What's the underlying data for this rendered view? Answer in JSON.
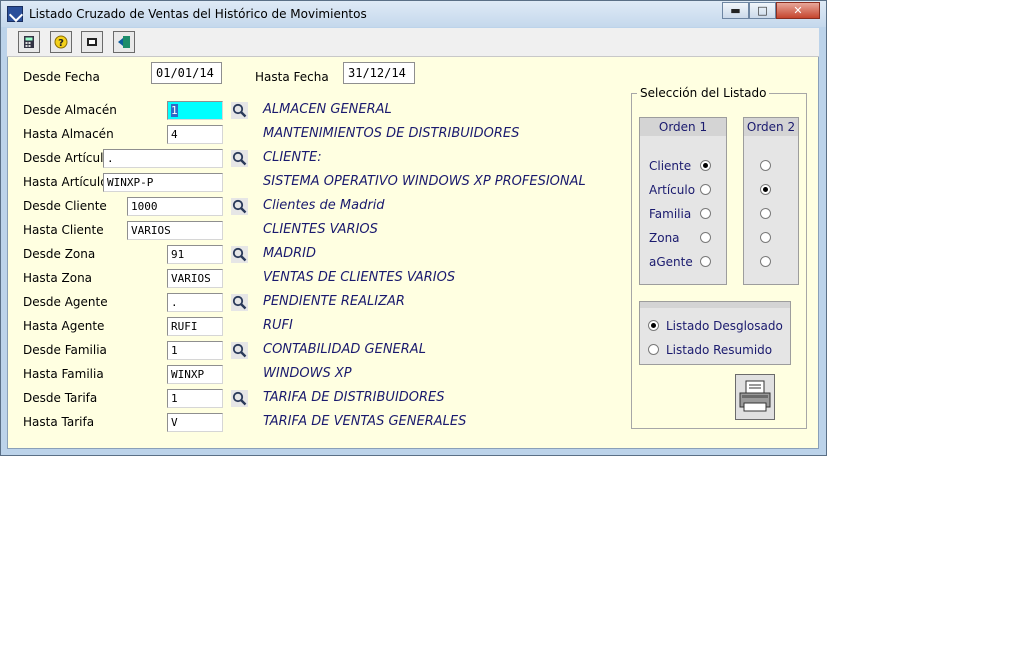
{
  "window": {
    "title": "Listado Cruzado de Ventas del Histórico de Movimientos",
    "controls": {
      "minimize": "▬",
      "maximize": "□",
      "close": "✕"
    }
  },
  "toolbar": {
    "buttons": [
      {
        "name": "calculator-icon"
      },
      {
        "name": "help-icon"
      },
      {
        "name": "print-preview-icon"
      },
      {
        "name": "exit-icon"
      }
    ]
  },
  "dates": {
    "desde_label": "Desde Fecha",
    "desde_value": "01/01/14",
    "hasta_label": "Hasta Fecha",
    "hasta_value": "31/12/14"
  },
  "rows": [
    {
      "label": "Desde Almacén",
      "value": "1",
      "desc": "ALMACEN GENERAL",
      "search": true
    },
    {
      "label": "Hasta Almacén",
      "value": "4",
      "desc": "MANTENIMIENTOS DE DISTRIBUIDORES",
      "search": false
    },
    {
      "label": "Desde Artículo",
      "value": ".",
      "desc": "CLIENTE:",
      "search": true
    },
    {
      "label": "Hasta Artículo",
      "value": "WINXP-P",
      "desc": "SISTEMA OPERATIVO WINDOWS XP PROFESIONAL",
      "search": false
    },
    {
      "label": "Desde Cliente",
      "value": "1000",
      "desc": "Clientes de Madrid",
      "search": true
    },
    {
      "label": "Hasta Cliente",
      "value": "VARIOS",
      "desc": "CLIENTES VARIOS",
      "search": false
    },
    {
      "label": "Desde Zona",
      "value": "91",
      "desc": "MADRID",
      "search": true
    },
    {
      "label": "Hasta Zona",
      "value": "VARIOS",
      "desc": "VENTAS DE CLIENTES VARIOS",
      "search": false
    },
    {
      "label": "Desde Agente",
      "value": ".",
      "desc": "PENDIENTE REALIZAR",
      "search": true
    },
    {
      "label": "Hasta Agente",
      "value": "RUFI",
      "desc": "RUFI",
      "search": false
    },
    {
      "label": "Desde Familia",
      "value": "1",
      "desc": "CONTABILIDAD GENERAL",
      "search": true
    },
    {
      "label": "Hasta Familia",
      "value": "WINXP",
      "desc": "WINDOWS XP",
      "search": false
    },
    {
      "label": "Desde Tarifa",
      "value": "1",
      "desc": "TARIFA DE DISTRIBUIDORES",
      "search": true
    },
    {
      "label": "Hasta Tarifa",
      "value": "V",
      "desc": "TARIFA DE VENTAS GENERALES",
      "search": false
    }
  ],
  "seleccion": {
    "title": "Selección del Listado",
    "orden1": "Orden 1",
    "orden2": "Orden 2",
    "options": [
      "Cliente",
      "Artículo",
      "Familia",
      "Zona",
      "aGente"
    ],
    "orden1_selected": "Cliente",
    "orden2_selected": "Artículo",
    "tipo": [
      "Listado Desglosado",
      "Listado Resumido"
    ],
    "tipo_selected": "Listado Desglosado"
  },
  "colors": {
    "window_frame": "#bcd3ea",
    "client_bg": "#ffffe1",
    "description_text": "#1a1a6e",
    "active_field": "#00ffff"
  }
}
